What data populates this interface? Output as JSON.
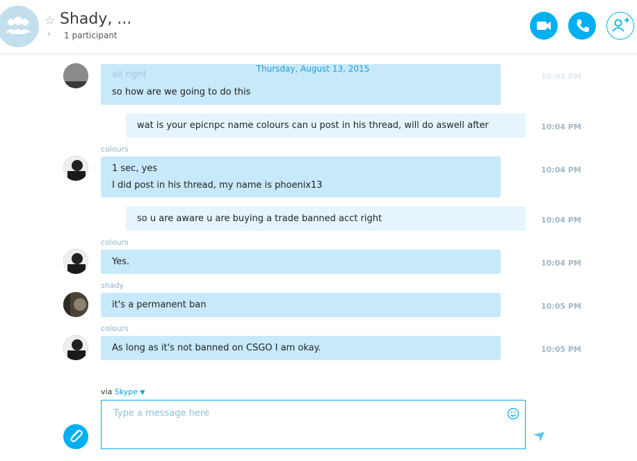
{
  "header": {
    "title": "Shady, ...",
    "participants": "1 participant"
  },
  "date_separator": "Thursday, August 13, 2015",
  "messages": [
    {
      "sender": "",
      "lines": [
        "all right",
        "so how are we going to do this"
      ],
      "time": "10:04 PM",
      "own": false
    },
    {
      "sender": "",
      "lines": [
        "wat is your epicnpc name colours can u post in his thread, will do aswell after"
      ],
      "time": "10:04 PM",
      "own": true
    },
    {
      "sender": "colours",
      "lines": [
        "1 sec, yes",
        "I did post in his thread, my name is phoenix13"
      ],
      "time": "10:04 PM",
      "own": false
    },
    {
      "sender": "",
      "lines": [
        "so u are aware u are buying a trade banned acct right"
      ],
      "time": "10:04 PM",
      "own": true
    },
    {
      "sender": "colours",
      "lines": [
        "Yes."
      ],
      "time": "10:04 PM",
      "own": false
    },
    {
      "sender": "shady",
      "lines": [
        "it's a permanent ban"
      ],
      "time": "10:05 PM",
      "own": false
    },
    {
      "sender": "colours",
      "lines": [
        "As long as it's not banned on CSGO I am okay."
      ],
      "time": "10:05 PM",
      "own": false
    }
  ],
  "composer": {
    "via": "via",
    "via_link": "Skype",
    "placeholder": "Type a message here"
  },
  "icons": {
    "video": "video-camera-icon",
    "call": "phone-icon",
    "add": "add-contact-icon",
    "attach": "paperclip-icon",
    "emoji": "smiley-icon",
    "send": "send-arrow-icon"
  },
  "colors": {
    "accent": "#00aff0",
    "bubble_in": "#c7e9fa",
    "bubble_out": "#e6f5fd"
  }
}
